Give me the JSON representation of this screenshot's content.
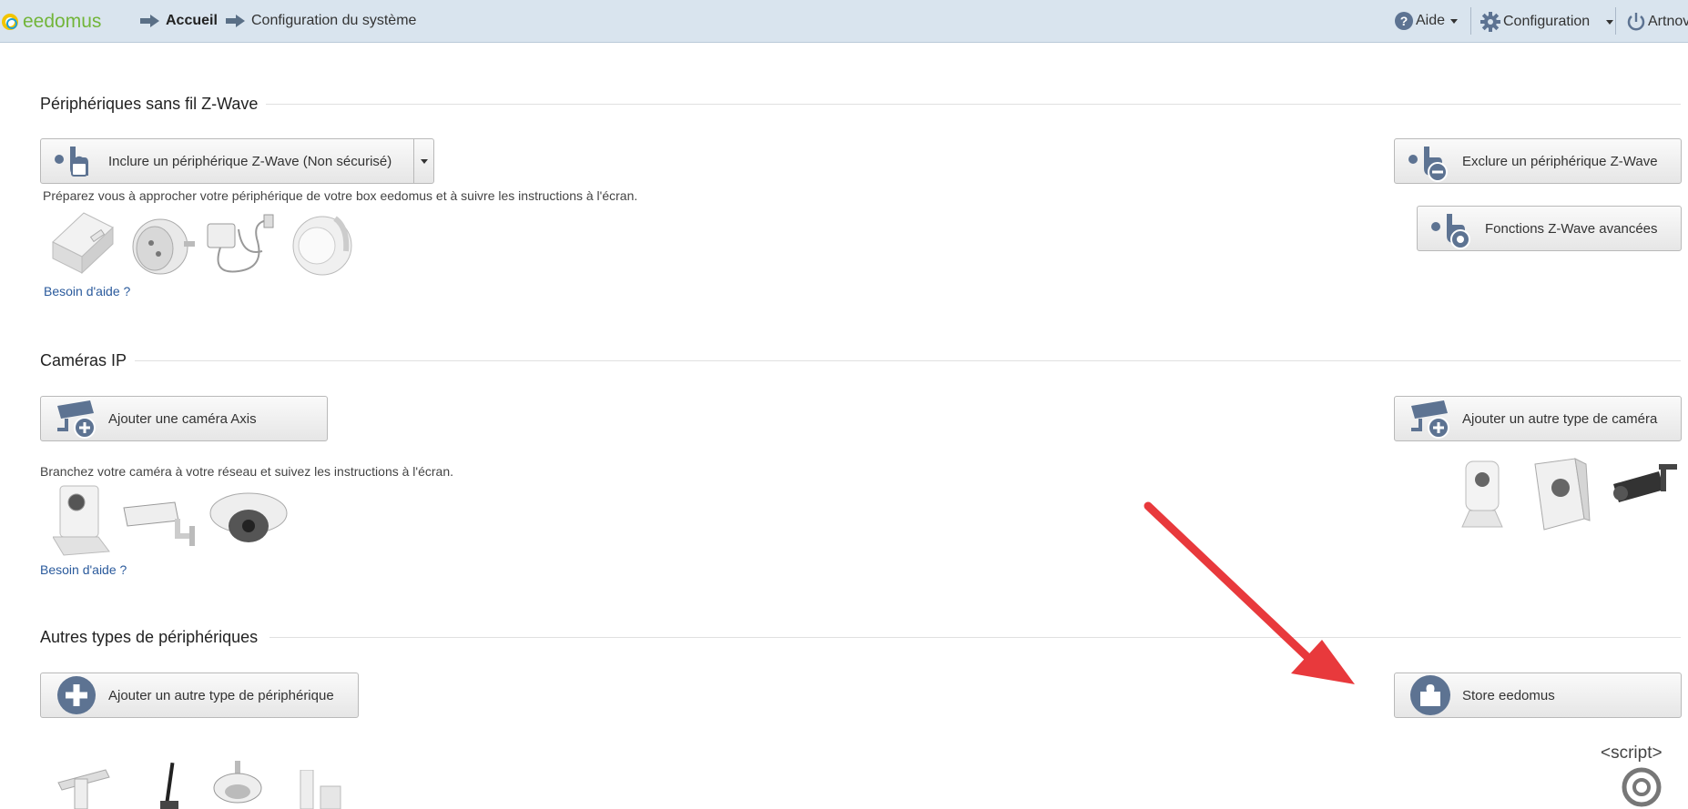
{
  "header": {
    "logo_text": "eedomus",
    "breadcrumbs": [
      "Accueil",
      "Configuration du système"
    ],
    "help_menu": "Aide",
    "config_menu": "Configuration",
    "user_menu": "Artnov"
  },
  "sections": {
    "zwave": {
      "title": "Périphériques sans fil Z-Wave",
      "include_button": "Inclure un périphérique Z-Wave (Non sécurisé)",
      "exclude_button": "Exclure un périphérique Z-Wave",
      "advanced_button": "Fonctions Z-Wave avancées",
      "help_text": "Préparez vous à approcher votre périphérique de votre box eedomus et à suivre les instructions à l'écran.",
      "help_link": "Besoin d'aide ?"
    },
    "cameras": {
      "title": "Caméras IP",
      "axis_button": "Ajouter une caméra Axis",
      "other_button": "Ajouter un autre type de caméra",
      "help_text": "Branchez votre caméra à votre réseau et suivez les instructions à l'écran.",
      "help_link": "Besoin d'aide ?"
    },
    "others": {
      "title": "Autres types de périphériques",
      "add_button": "Ajouter un autre type de périphérique",
      "store_button": "Store eedomus",
      "script_label": "<script>"
    }
  },
  "colors": {
    "topbar": "#d9e4ee",
    "icon_blue": "#5d7392",
    "link": "#2a5a9c",
    "annotation_arrow": "#e8393c"
  }
}
